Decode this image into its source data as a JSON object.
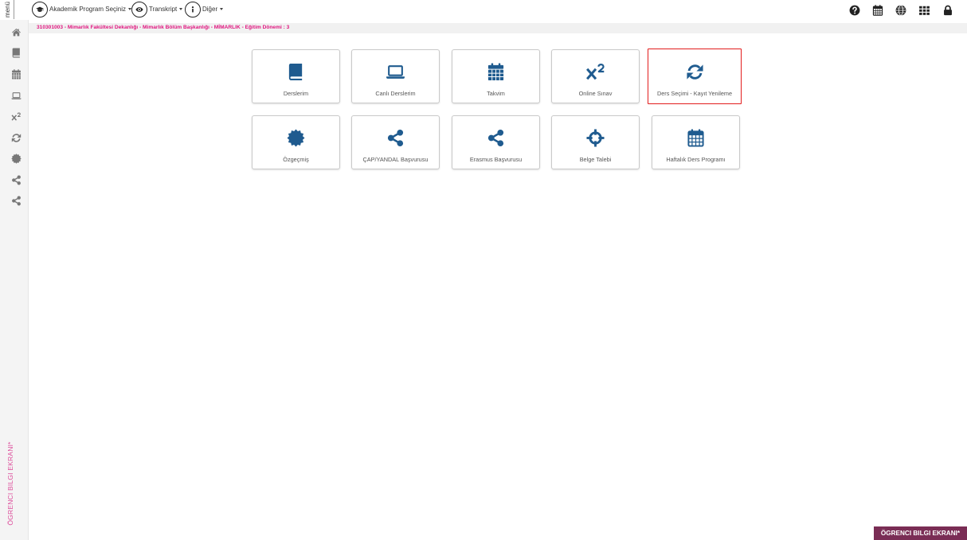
{
  "colors": {
    "breadcrumb_text": "#e0157f",
    "side_label": "#dd4f9c",
    "tile_icon": "#1f5b8f",
    "sidebar_icon": "#777777",
    "highlight_border": "#e21c1c",
    "badge_bg": "#7a2d55",
    "topbar_icon": "#222222"
  },
  "topbar": {
    "menu_label": "menü",
    "dropdowns": [
      {
        "label": "Akademik Program Seçiniz",
        "icon": "graduation-cap-icon"
      },
      {
        "label": "Transkript",
        "icon": "eye-icon"
      },
      {
        "label": "Diğer",
        "icon": "info-icon"
      }
    ],
    "right_icons": [
      "question-circle-icon",
      "calendar-icon",
      "globe-icon",
      "grid-icon",
      "lock-icon"
    ]
  },
  "sidebar": {
    "items": [
      {
        "icon": "home-icon"
      },
      {
        "icon": "book-icon"
      },
      {
        "icon": "calendar-icon"
      },
      {
        "icon": "laptop-icon"
      },
      {
        "icon": "superscript-icon"
      },
      {
        "icon": "refresh-icon"
      },
      {
        "icon": "certificate-icon"
      },
      {
        "icon": "share-icon"
      },
      {
        "icon": "share-icon"
      }
    ],
    "vertical_label": "ÖGRENCI BILGI EKRANI*"
  },
  "breadcrumb": {
    "text": "310301003 - Mimarlık Fakültesi Dekanlığı - Mimarlık Bölüm Başkanlığı - MİMARLIK - Eğitim Dönemi : 3"
  },
  "tiles": [
    {
      "label": "Derslerim",
      "icon": "book-icon"
    },
    {
      "label": "Canlı Derslerim",
      "icon": "laptop-icon"
    },
    {
      "label": "Takvim",
      "icon": "calendar-icon"
    },
    {
      "label": "Online Sınav",
      "icon": "superscript-icon"
    },
    {
      "label": "Ders Seçimi - Kayıt Yenileme",
      "icon": "refresh-icon",
      "highlighted": true
    },
    {
      "label": "Özgeçmiş",
      "icon": "certificate-icon"
    },
    {
      "label": "ÇAP/YANDAL Başvurusu",
      "icon": "share-icon"
    },
    {
      "label": "Erasmus Başvurusu",
      "icon": "share-icon"
    },
    {
      "label": "Belge Talebi",
      "icon": "crosshairs-icon"
    },
    {
      "label": "Haftalık Ders Programı",
      "icon": "calendar-week-icon"
    }
  ],
  "footer": {
    "badge": "ÖGRENCI BILGI EKRANI*"
  }
}
